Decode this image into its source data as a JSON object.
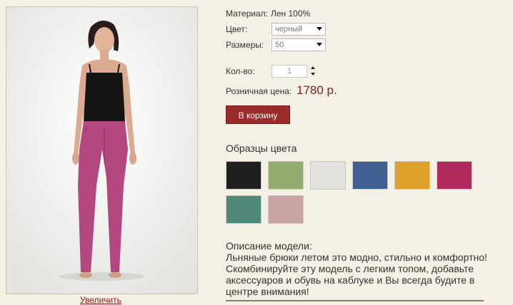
{
  "product": {
    "material_label": "Материал:",
    "material_value": "Лен 100%",
    "color_label": "Цвет:",
    "color_selected": "черный",
    "size_label": "Размеры:",
    "size_selected": "50",
    "qty_label": "Кол-во:",
    "qty_value": "1",
    "price_label": "Розничная цена:",
    "price_value": "1780 р.",
    "cart_button": "В корзину",
    "enlarge_link": "Увеличить"
  },
  "swatches": {
    "title": "Образцы цвета",
    "items": [
      {
        "name": "black",
        "color": "#1f1f1f"
      },
      {
        "name": "green",
        "color": "#93ad6e"
      },
      {
        "name": "light-grey",
        "color": "#e3e1dd"
      },
      {
        "name": "blue",
        "color": "#3f6090"
      },
      {
        "name": "mustard",
        "color": "#e0a12c"
      },
      {
        "name": "magenta",
        "color": "#b02a5e"
      },
      {
        "name": "teal",
        "color": "#4f8779"
      },
      {
        "name": "pink",
        "color": "#c9a4a4"
      }
    ]
  },
  "description": {
    "title": "Описание модели:",
    "lines": [
      "Льняные брюки летом это модно, стильно и комфортно!",
      "Скомбинируйте эту модель с легким топом, добавьте",
      "аксессуаров и обувь на каблуке и Вы всегда будите в",
      "центре внимания!"
    ]
  },
  "colors": {
    "accent": "#9b2a2a",
    "price": "#8b1a1a",
    "background": "#f5f0e6"
  }
}
